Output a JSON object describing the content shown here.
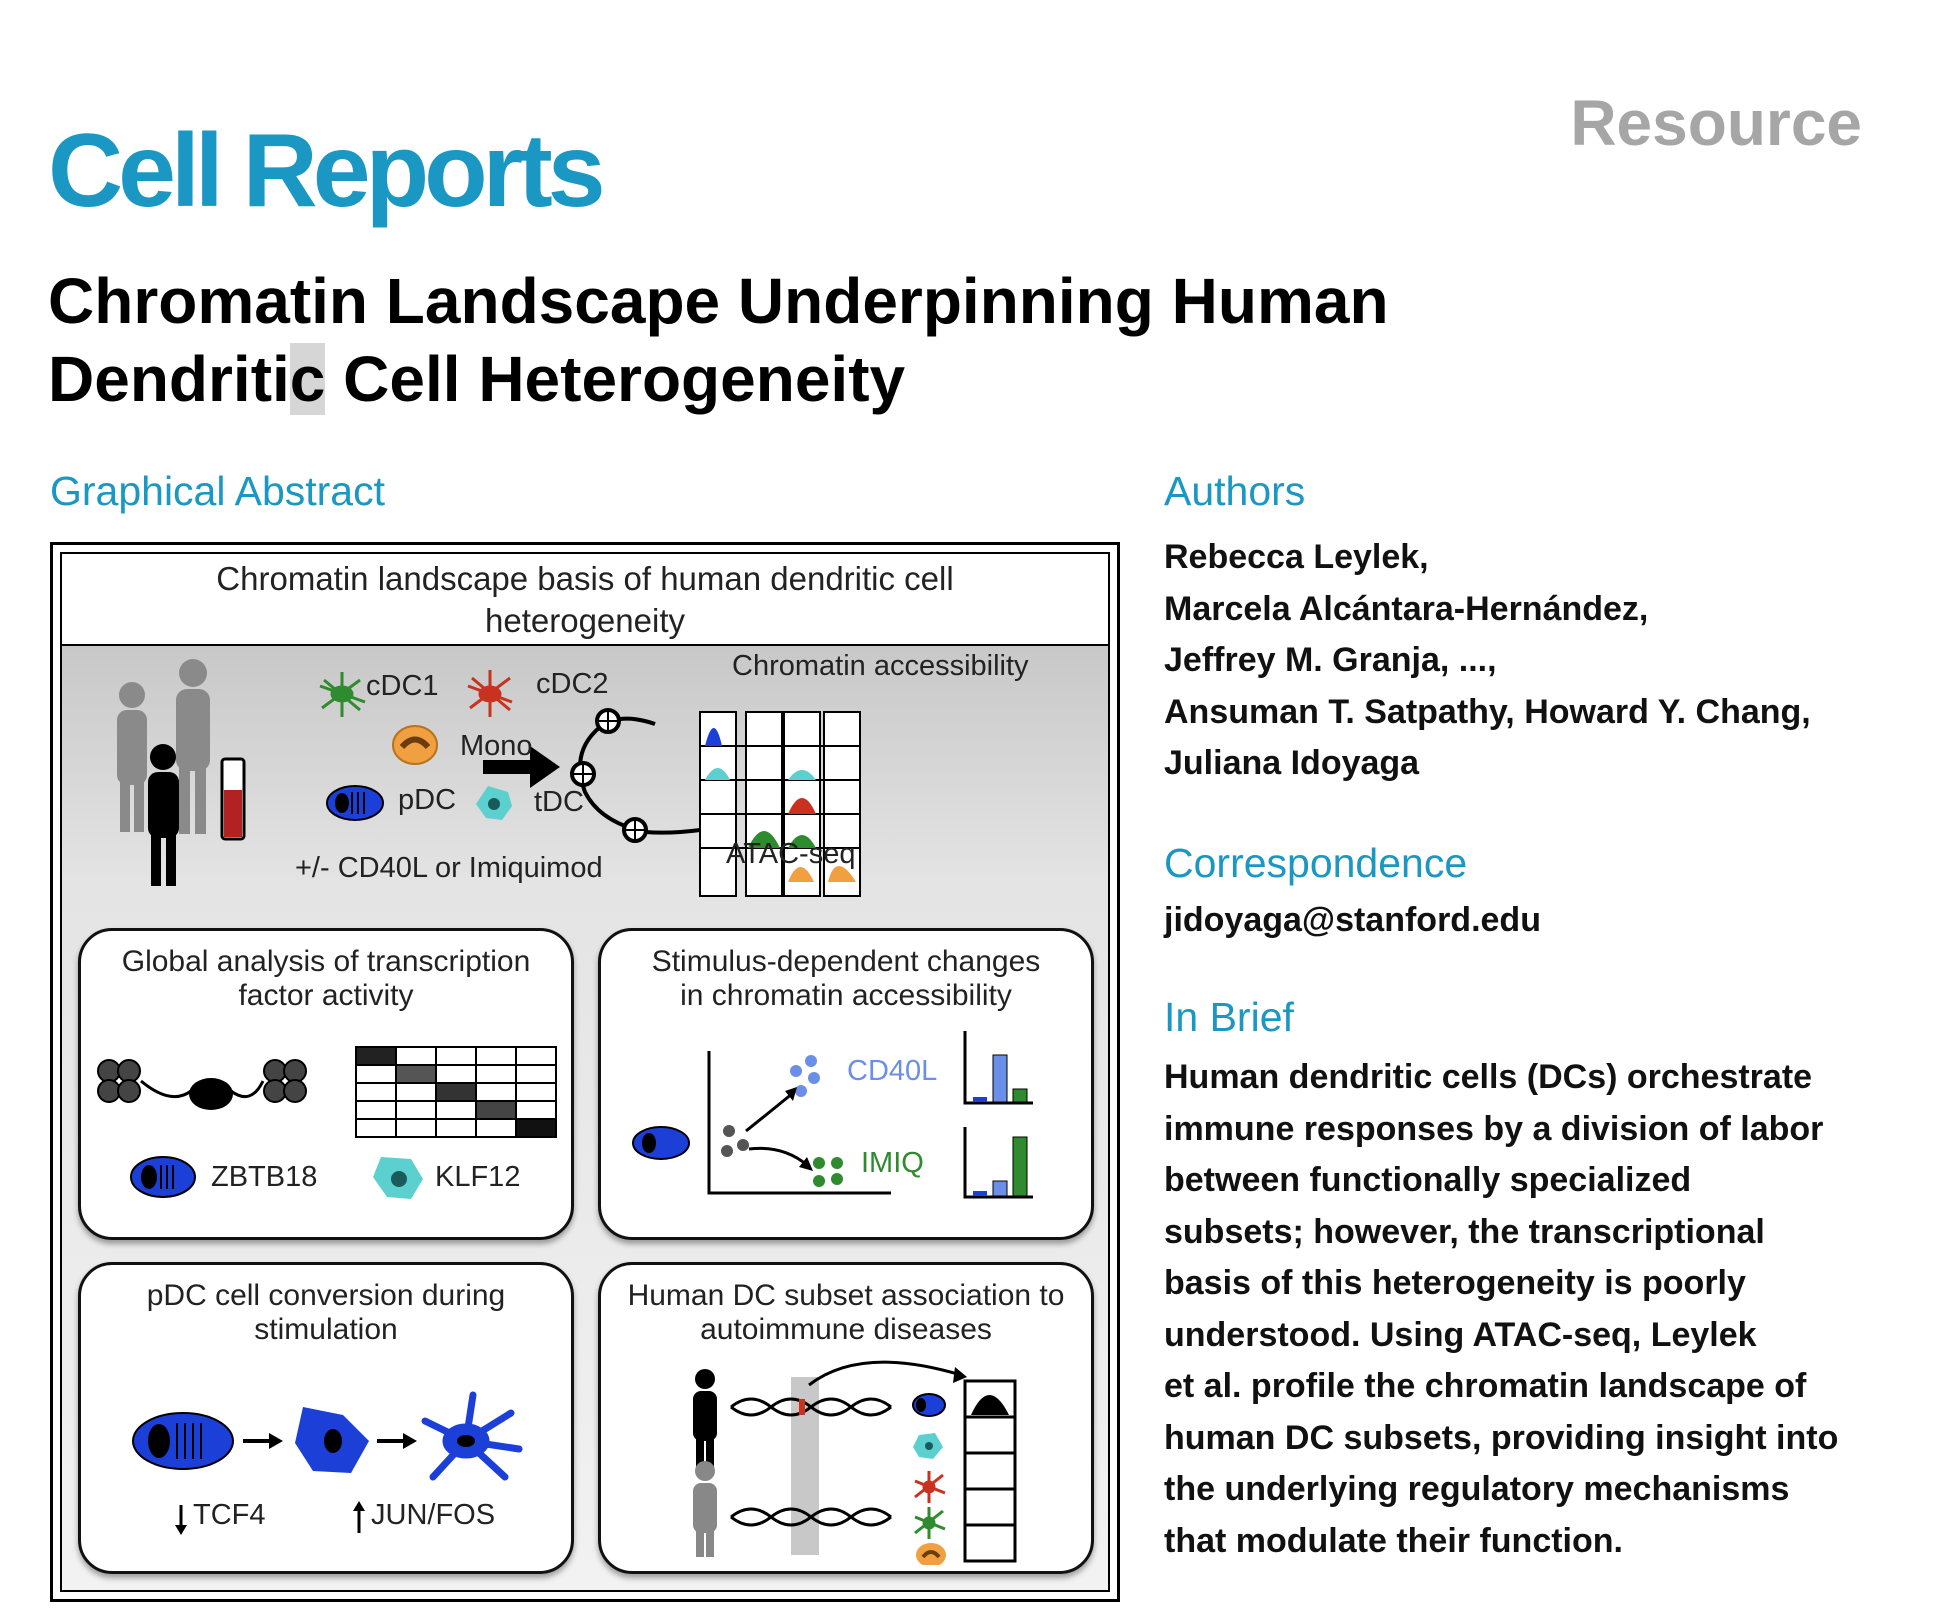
{
  "journal": "Cell Reports",
  "doc_type": "Resource",
  "title_line1": "Chromatin Landscape Underpinning Human",
  "title_line2_a": "Dendriti",
  "title_line2_b": "c",
  "title_line2_c": " Cell Heterogeneity",
  "sections": {
    "graphical_abstract": "Graphical Abstract",
    "authors": "Authors",
    "correspondence": "Correspondence",
    "in_brief": "In Brief"
  },
  "authors": [
    "Rebecca Leylek,",
    "Marcela Alcántara-Hernández,",
    "Jeffrey M. Granja, ...,",
    "Ansuman T. Satpathy, Howard Y. Chang,",
    "Juliana Idoyaga"
  ],
  "correspondence_email": "jidoyaga@stanford.edu",
  "in_brief_lines": [
    "Human dendritic cells (DCs) orchestrate",
    "immune responses by a division of labor",
    "between functionally specialized",
    "subsets; however, the transcriptional",
    "basis of this heterogeneity is poorly",
    "understood. Using ATAC-seq, Leylek",
    "et al. profile the chromatin landscape of",
    "human DC subsets, providing insight into",
    "the underlying regulatory mechanisms",
    "that modulate their function."
  ],
  "abstract": {
    "header_line1": "Chromatin landscape basis of human dendritic cell",
    "header_line2": "heterogeneity",
    "cells": {
      "cdc1": "cDC1",
      "cdc2": "cDC2",
      "mono": "Mono",
      "pdc": "pDC",
      "tdc": "tDC"
    },
    "stimulus": "+/- CD40L or Imiquimod",
    "chromatin_accessibility": "Chromatin accessibility",
    "atac": "ATAC-seq",
    "panel1": {
      "title_line1": "Global analysis of transcription",
      "title_line2": "factor activity",
      "factor1": "ZBTB18",
      "factor2": "KLF12"
    },
    "panel2": {
      "title_line1": "Stimulus-dependent changes",
      "title_line2": "in chromatin accessibility",
      "cond1": "CD40L",
      "cond2": "IMIQ"
    },
    "panel3": {
      "title_line1": "pDC cell conversion during",
      "title_line2": "stimulation",
      "down": "TCF4",
      "up": "JUN/FOS"
    },
    "panel4": {
      "title_line1": "Human DC subset association to",
      "title_line2": "autoimmune diseases"
    },
    "colors": {
      "cdc1": "#2e8b2e",
      "cdc2": "#c8321e",
      "mono": "#f0a040",
      "pdc": "#1c3fd8",
      "tdc": "#5ccfcf",
      "accent": "#1b97c4"
    }
  }
}
